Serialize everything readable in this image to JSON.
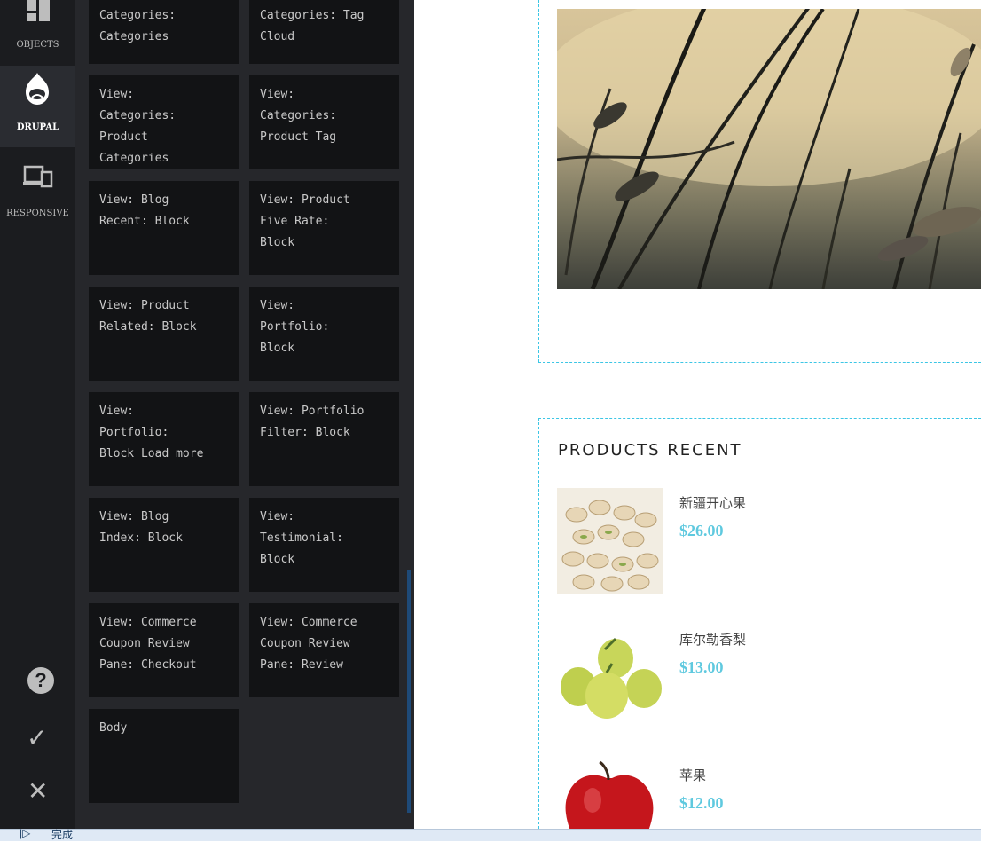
{
  "sidebar": {
    "items": [
      {
        "label": "OBJECTS",
        "icon": "objects-icon"
      },
      {
        "label": "DRUPAL",
        "icon": "drupal-icon"
      },
      {
        "label": "RESPONSIVE",
        "icon": "responsive-icon"
      }
    ],
    "bottom": [
      {
        "icon": "help-icon",
        "glyph": "?"
      },
      {
        "icon": "check-icon",
        "glyph": "✓"
      },
      {
        "icon": "close-icon",
        "glyph": "✕"
      }
    ]
  },
  "blocks": [
    "Categories:\nCategories",
    "Categories: Tag\nCloud",
    "View:\nCategories:\nProduct\nCategories",
    "View:\nCategories:\nProduct Tag",
    "View: Blog\nRecent: Block",
    "View: Product\nFive Rate:\nBlock",
    "View: Product\nRelated: Block",
    "View:\nPortfolio:\nBlock",
    "View:\nPortfolio:\nBlock Load more",
    "View: Portfolio\nFilter: Block",
    "View: Blog\nIndex: Block",
    "View:\nTestimonial:\nBlock",
    "View: Commerce\nCoupon Review\nPane: Checkout",
    "View: Commerce\nCoupon Review\nPane: Review",
    "Body"
  ],
  "products_section": {
    "title": "PRODUCTS RECENT",
    "items": [
      {
        "name": "新疆开心果",
        "price": "$26.00"
      },
      {
        "name": "库尔勒香梨",
        "price": "$13.00"
      },
      {
        "name": "苹果",
        "price": "$12.00"
      }
    ]
  },
  "statusbar": {
    "text": "完成"
  },
  "colors": {
    "accent": "#5fc9df",
    "guide": "#3cc6e5",
    "panel": "#26272b",
    "tile": "#121315"
  }
}
